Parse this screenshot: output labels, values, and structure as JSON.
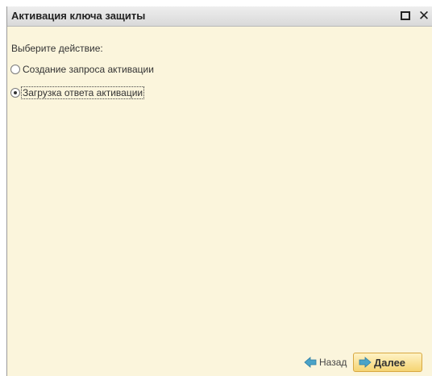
{
  "window": {
    "title": "Активация ключа защиты",
    "maximize_icon": "maximize-icon",
    "close_icon": "close-icon",
    "close_glyph": "✕"
  },
  "form": {
    "prompt": "Выберите действие:",
    "options": [
      {
        "label": "Создание запроса активации",
        "selected": false
      },
      {
        "label": "Загрузка ответа активации",
        "selected": true
      }
    ]
  },
  "footer": {
    "back_label": "Назад",
    "next_label": "Далее",
    "back_icon": "arrow-left-icon",
    "next_icon": "arrow-right-icon"
  },
  "colors": {
    "background": "#fbf5dc",
    "titlebar": "#e4e4e4",
    "next_button": "#f5d472",
    "arrow_icon": "#4aa3c8"
  }
}
